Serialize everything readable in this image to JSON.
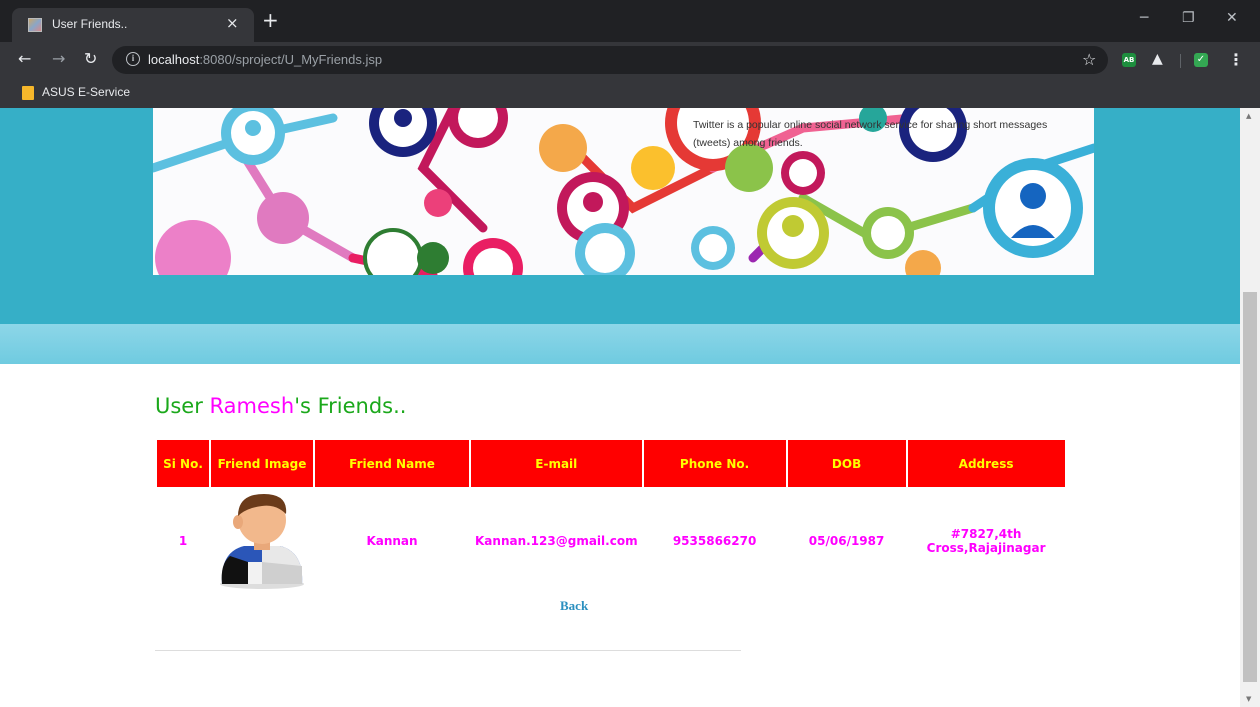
{
  "browser": {
    "tab_title": "User Friends..",
    "tab_close": "×",
    "new_tab": "+",
    "url_host": "localhost",
    "url_rest": ":8080/sproject/U_MyFriends.jsp",
    "bookmark_label": "ASUS E-Service",
    "extension_ab_label": "AB"
  },
  "banner": {
    "text": "Twitter is a popular online social network service for sharing short messages (tweets) among friends."
  },
  "page": {
    "heading_prefix": "User ",
    "user_name": "Ramesh",
    "heading_suffix": "'s Friends..",
    "back_label": "Back"
  },
  "table": {
    "headers": [
      "Si No.",
      "Friend Image",
      "Friend Name",
      "E-mail",
      "Phone No.",
      "DOB",
      "Address"
    ],
    "rows": [
      {
        "si_no": "1",
        "name": "Kannan",
        "email": "Kannan.123@gmail.com",
        "phone": "9535866270",
        "dob": "05/06/1987",
        "address": "#7827,4th Cross,Rajajinagar"
      }
    ]
  },
  "colors": {
    "header_band": "#36afc7",
    "table_header_bg": "#ff0000",
    "table_header_text": "#ffff00",
    "cell_text": "#ff00ff",
    "heading_green": "#1ba81b",
    "back_link": "#2a8fbf"
  },
  "icons": {
    "tab_favicon": "page-favicon",
    "reload": "reload-icon",
    "info": "info-icon",
    "bookmark_star": "star-icon",
    "menu": "kebab-menu-icon"
  }
}
